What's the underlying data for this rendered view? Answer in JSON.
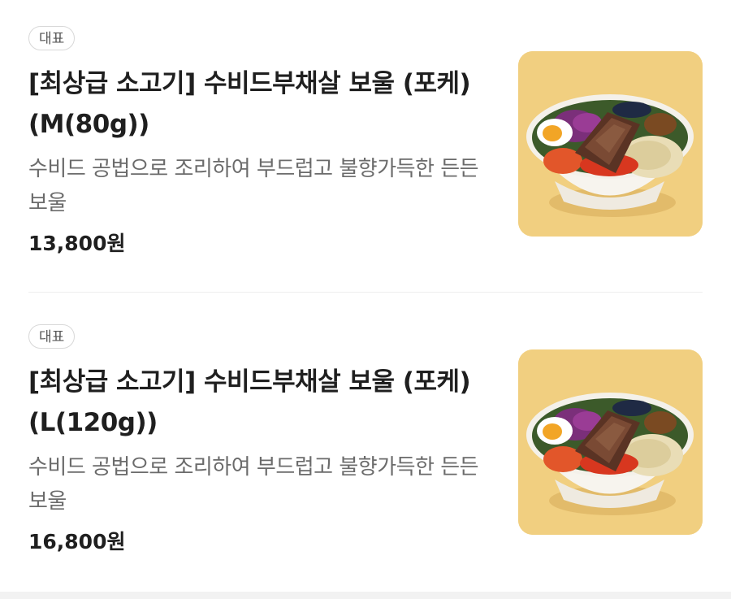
{
  "items": [
    {
      "badge": "대표",
      "title": "[최상급 소고기] 수비드부채살 보울 (포케)(M(80g))",
      "description": "수비드 공법으로 조리하여 부드럽고 불향가득한 든든 보울",
      "price": "13,800원",
      "image": "beef-poke-bowl"
    },
    {
      "badge": "대표",
      "title": "[최상급 소고기] 수비드부채살 보울 (포케)(L(120g))",
      "description": "수비드 공법으로 조리하여 부드럽고 불향가득한 든든 보울",
      "price": "16,800원",
      "image": "beef-poke-bowl"
    }
  ],
  "colors": {
    "image_background": "#f1cf80",
    "divider": "#eeeeee"
  }
}
